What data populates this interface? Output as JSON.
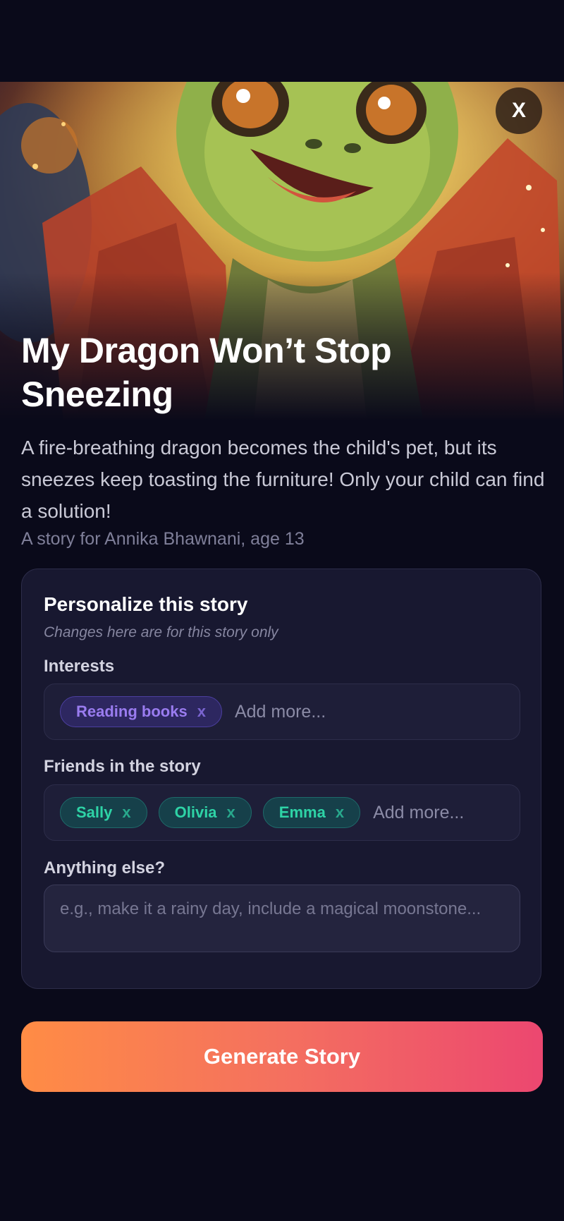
{
  "hero": {
    "close_label": "X"
  },
  "story": {
    "title": "My Dragon Won’t Stop Sneezing",
    "description": "A fire-breathing dragon becomes the child's pet, but its sneezes keep toasting the furniture! Only your child can find a solution!",
    "byline": "A story for Annika Bhawnani, age 13"
  },
  "personalize": {
    "title": "Personalize this story",
    "subtitle": "Changes here are for this story only",
    "interests": {
      "label": "Interests",
      "tags": [
        {
          "label": "Reading books",
          "remove": "x"
        }
      ],
      "placeholder": "Add more..."
    },
    "friends": {
      "label": "Friends in the story",
      "tags": [
        {
          "label": "Sally",
          "remove": "x"
        },
        {
          "label": "Olivia",
          "remove": "x"
        },
        {
          "label": "Emma",
          "remove": "x"
        }
      ],
      "placeholder": "Add more..."
    },
    "extra": {
      "label": "Anything else?",
      "placeholder": "e.g., make it a rainy day, include a magical moonstone..."
    }
  },
  "actions": {
    "generate_label": "Generate Story"
  },
  "colors": {
    "background": "#0a0a1a",
    "card": "#181830",
    "interest_chip": "#9a7cf0",
    "friend_chip": "#2ed3a6",
    "button_gradient_start": "#ff8c45",
    "button_gradient_end": "#ec4770"
  },
  "icons": {
    "close": "close-icon",
    "cover": "dragon-cover-illustration"
  }
}
